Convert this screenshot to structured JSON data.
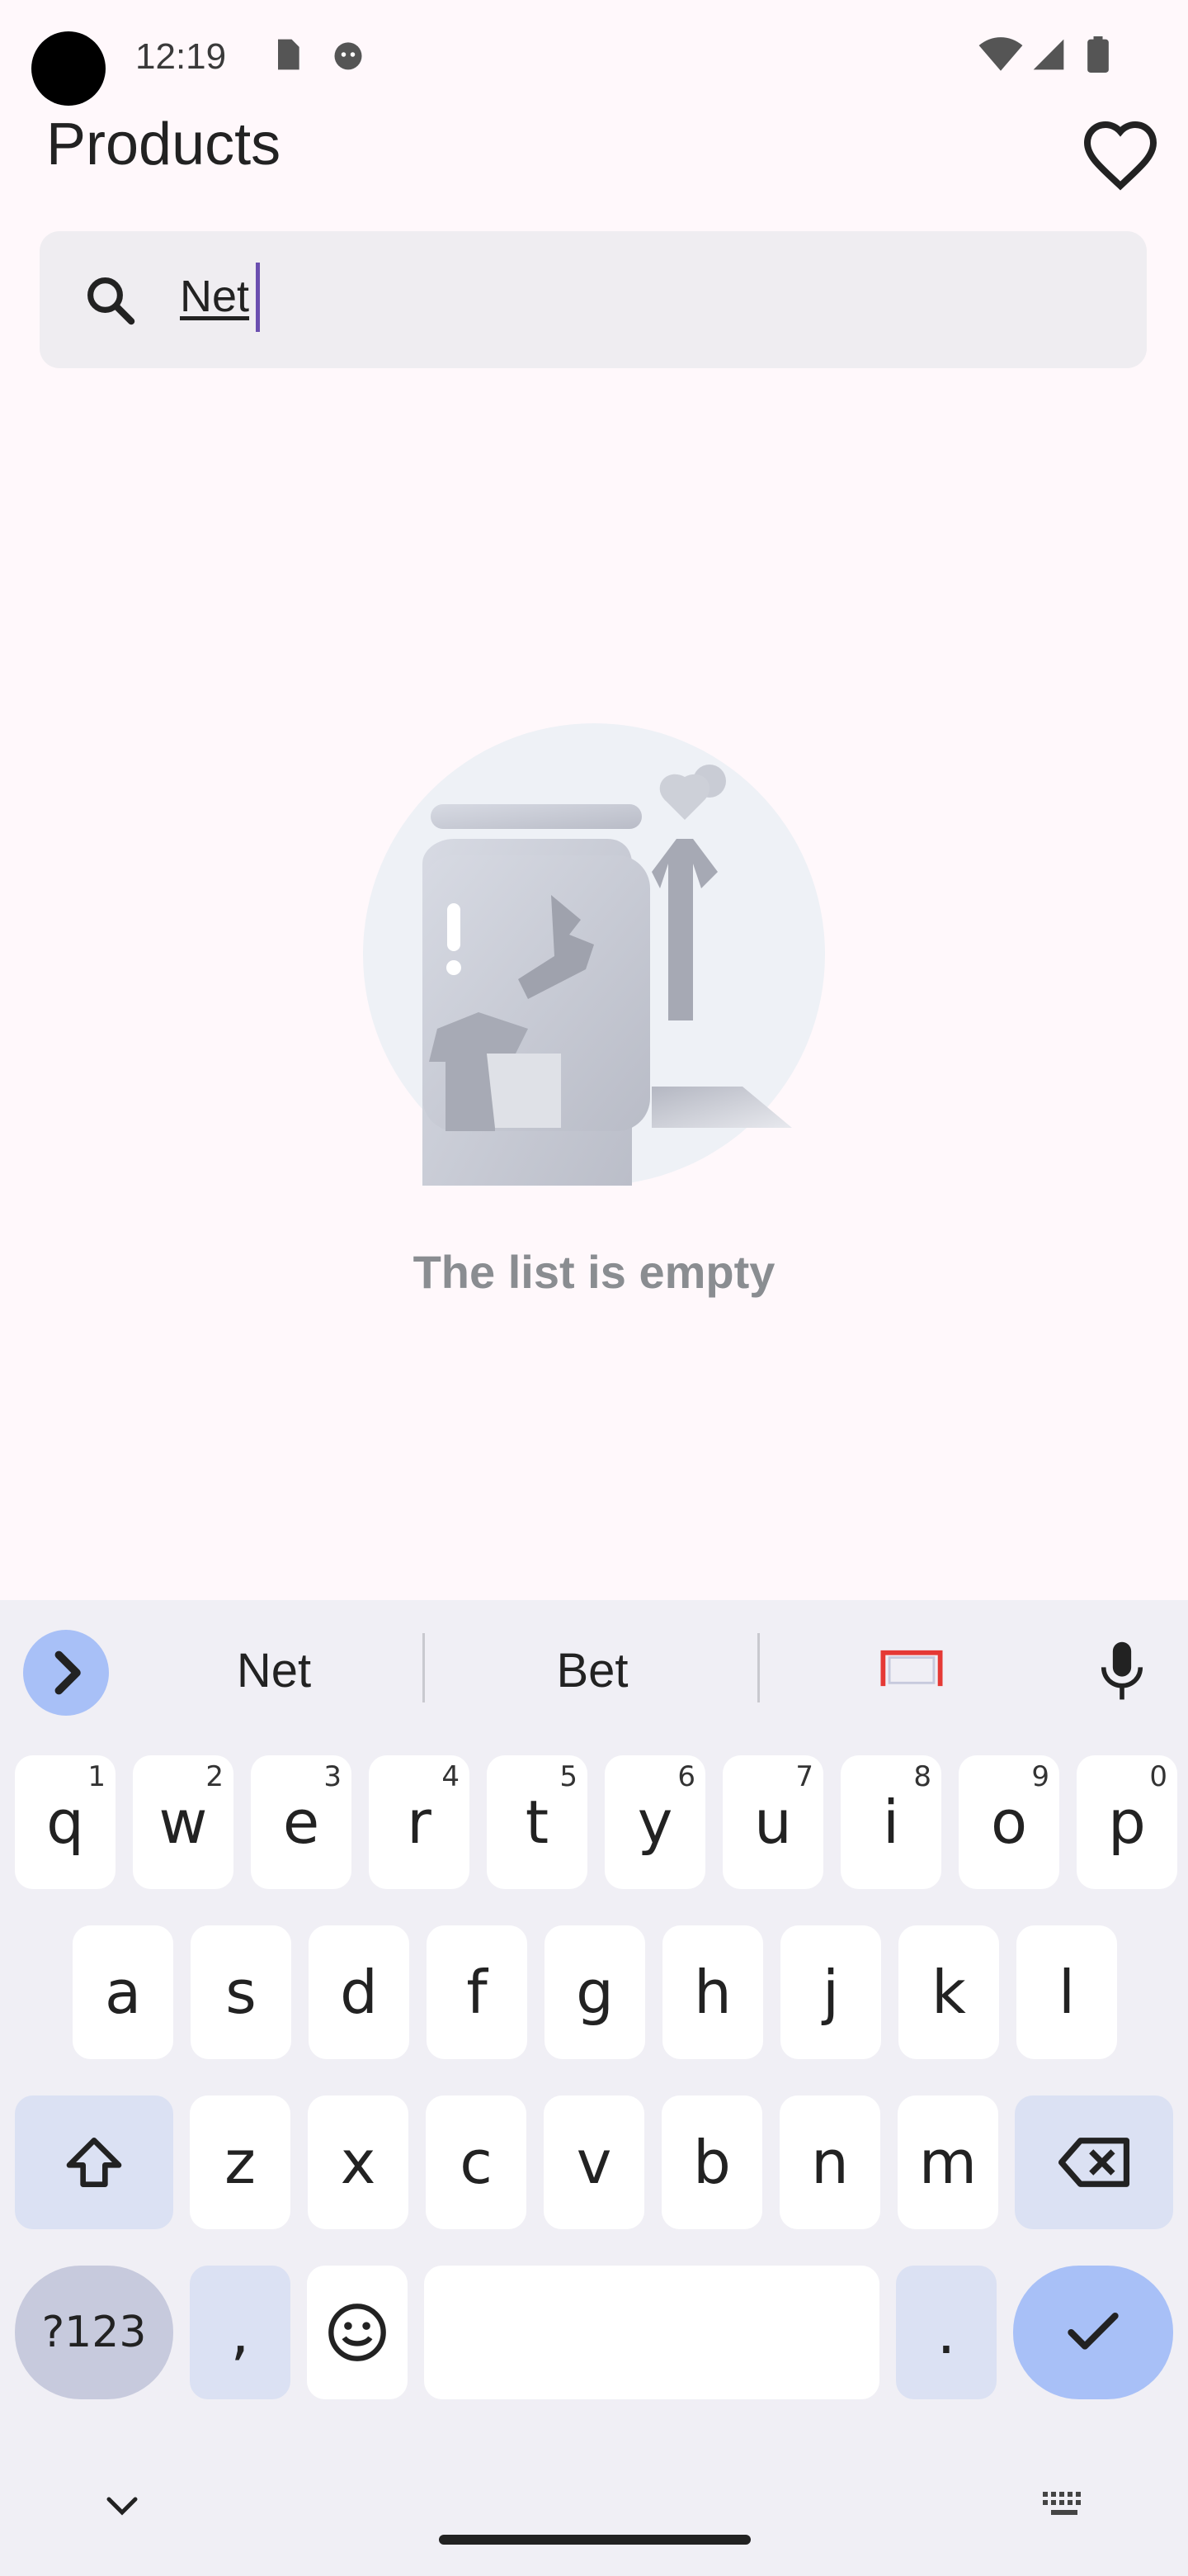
{
  "status_bar": {
    "time": "12:19"
  },
  "header": {
    "title": "Products"
  },
  "search": {
    "value": "Net"
  },
  "empty_state": {
    "message": "The list is empty"
  },
  "keyboard": {
    "suggestions": [
      "Net",
      "Bet"
    ],
    "row1": [
      {
        "k": "q",
        "s": "1"
      },
      {
        "k": "w",
        "s": "2"
      },
      {
        "k": "e",
        "s": "3"
      },
      {
        "k": "r",
        "s": "4"
      },
      {
        "k": "t",
        "s": "5"
      },
      {
        "k": "y",
        "s": "6"
      },
      {
        "k": "u",
        "s": "7"
      },
      {
        "k": "i",
        "s": "8"
      },
      {
        "k": "o",
        "s": "9"
      },
      {
        "k": "p",
        "s": "0"
      }
    ],
    "row2": [
      "a",
      "s",
      "d",
      "f",
      "g",
      "h",
      "j",
      "k",
      "l"
    ],
    "row3": [
      "z",
      "x",
      "c",
      "v",
      "b",
      "n",
      "m"
    ],
    "sym_label": "?123",
    "comma": ",",
    "period": "."
  },
  "colors": {
    "accent": "#a8c0f7",
    "caret": "#6b4fb0",
    "background": "#fff8fb"
  }
}
